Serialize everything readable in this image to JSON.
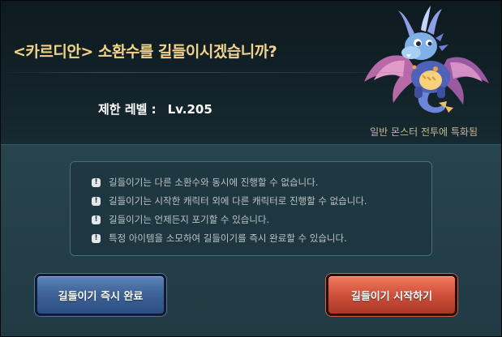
{
  "dialog": {
    "title": "<카르디안> 소환수를 길들이시겠습니까?",
    "level_label": "제한 레벨 :",
    "level_value": "Lv.205",
    "special_note": "일반 몬스터 전투에 특화됨",
    "creature_icon": "dragon-creature-portrait"
  },
  "notices": [
    "길들이기는 다른 소환수와 동시에 진행할 수 없습니다.",
    "길들이기는 시작한 캐릭터 외에 다른 캐릭터로 진행할 수 없습니다.",
    "길들이기는 언제든지 포기할 수 있습니다.",
    "특정 아이템을 소모하여 길들이기를 즉시 완료할 수 있습니다."
  ],
  "buttons": {
    "instant_label": "길들이기 즉시 완료",
    "start_label": "길들이기 시작하기"
  },
  "colors": {
    "title": "#f3d38a",
    "instant_button": "#3e649a",
    "start_button": "#d4533c"
  }
}
